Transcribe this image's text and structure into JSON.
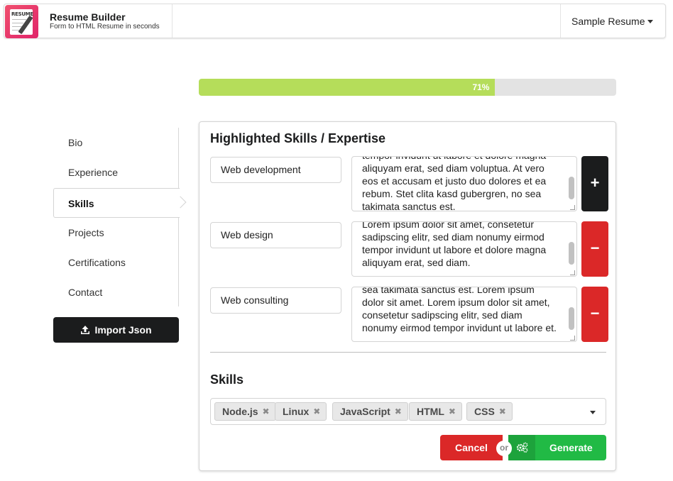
{
  "header": {
    "logo_text": "RESUME",
    "title": "Resume Builder",
    "subtitle": "Form to HTML Resume in seconds",
    "resume_selector": "Sample Resume"
  },
  "progress": {
    "percent": 71,
    "label": "71%"
  },
  "sidebar": {
    "items": [
      {
        "label": "Bio",
        "active": false
      },
      {
        "label": "Experience",
        "active": false
      },
      {
        "label": "Skills",
        "active": true
      },
      {
        "label": "Projects",
        "active": false
      },
      {
        "label": "Certifications",
        "active": false
      },
      {
        "label": "Contact",
        "active": false
      }
    ],
    "import_label": "Import Json"
  },
  "main": {
    "title": "Highlighted Skills / Expertise",
    "rows": [
      {
        "name": "Web development",
        "lines": [
          "tempor invidunt ut labore et dolore magna",
          "aliquyam erat, sed diam voluptua. At vero",
          "eos et accusam et justo duo dolores et ea",
          "rebum. Stet clita kasd gubergren, no sea",
          "takimata sanctus est."
        ],
        "action": "+"
      },
      {
        "name": "Web design",
        "lines": [
          "Lorem ipsum dolor sit amet, consetetur",
          "sadipscing elitr, sed diam nonumy eirmod",
          "tempor invidunt ut labore et dolore magna",
          "aliquyam erat, sed diam."
        ],
        "action": "−"
      },
      {
        "name": "Web consulting",
        "lines": [
          "sea takimata sanctus est. Lorem ipsum",
          "dolor sit amet. Lorem ipsum dolor sit amet,",
          "consetetur sadipscing elitr, sed diam",
          "nonumy eirmod tempor invidunt ut labore et."
        ],
        "action": "−"
      }
    ],
    "skills_title": "Skills",
    "skills_tags": [
      "Node.js",
      "Linux",
      "JavaScript",
      "HTML",
      "CSS"
    ],
    "cancel_label": "Cancel",
    "or_label": "or",
    "generate_label": "Generate"
  },
  "colors": {
    "progress_fill": "#b5dd5a",
    "danger": "#db2828",
    "success": "#21ba45",
    "dark": "#1b1c1d"
  },
  "icons": [
    "pencil-logo-icon",
    "caret-down-icon",
    "upload-icon",
    "plus-icon",
    "minus-icon",
    "remove-tag-icon",
    "gears-icon"
  ]
}
